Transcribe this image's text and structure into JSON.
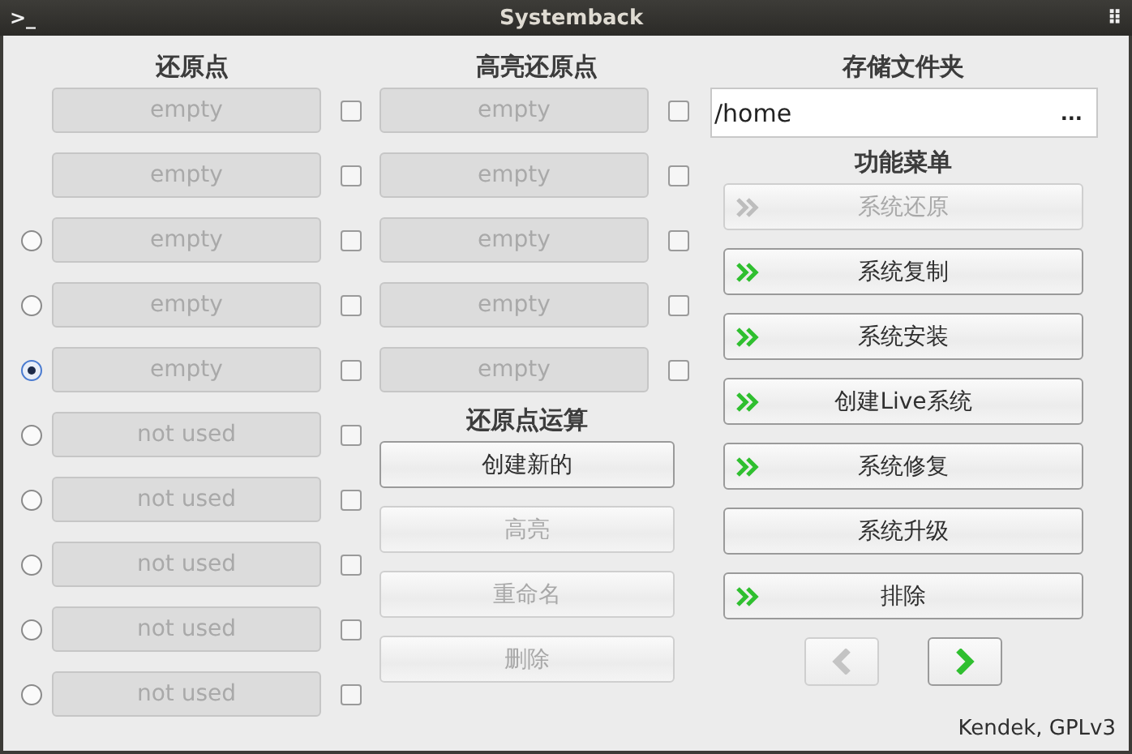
{
  "window": {
    "title": "Systemback",
    "terminal_glyph": ">_",
    "menu_glyph": "⠿"
  },
  "restore_points": {
    "title": "还原点",
    "items": [
      {
        "kind": "fixed",
        "text": "empty",
        "checked": false
      },
      {
        "kind": "fixed",
        "text": "empty",
        "checked": false
      },
      {
        "kind": "selectable",
        "text": "empty",
        "selected": false,
        "checked": false
      },
      {
        "kind": "selectable",
        "text": "empty",
        "selected": false,
        "checked": false
      },
      {
        "kind": "selectable",
        "text": "empty",
        "selected": true,
        "checked": false
      },
      {
        "kind": "selectable",
        "text": "not used",
        "selected": false,
        "checked": false
      },
      {
        "kind": "selectable",
        "text": "not used",
        "selected": false,
        "checked": false
      },
      {
        "kind": "selectable",
        "text": "not used",
        "selected": false,
        "checked": false
      },
      {
        "kind": "selectable",
        "text": "not used",
        "selected": false,
        "checked": false
      },
      {
        "kind": "selectable",
        "text": "not used",
        "selected": false,
        "checked": false
      }
    ]
  },
  "highlighted_points": {
    "title": "高亮还原点",
    "items": [
      {
        "text": "empty",
        "checked": false
      },
      {
        "text": "empty",
        "checked": false
      },
      {
        "text": "empty",
        "checked": false
      },
      {
        "text": "empty",
        "checked": false
      },
      {
        "text": "empty",
        "checked": false
      }
    ]
  },
  "operations": {
    "title": "还原点运算",
    "buttons": [
      {
        "label": "创建新的",
        "disabled": false
      },
      {
        "label": "高亮",
        "disabled": true
      },
      {
        "label": "重命名",
        "disabled": true
      },
      {
        "label": "删除",
        "disabled": true
      }
    ]
  },
  "storage": {
    "title": "存储文件夹",
    "path": "/home",
    "browse": "..."
  },
  "function_menu": {
    "title": "功能菜单",
    "buttons": [
      {
        "label": "系统还原",
        "disabled": true,
        "arrow": true
      },
      {
        "label": "系统复制",
        "disabled": false,
        "arrow": true
      },
      {
        "label": "系统安装",
        "disabled": false,
        "arrow": true
      },
      {
        "label": "创建Live系统",
        "disabled": false,
        "arrow": true
      },
      {
        "label": "系统修复",
        "disabled": false,
        "arrow": true
      },
      {
        "label": "系统升级",
        "disabled": false,
        "arrow": false
      },
      {
        "label": "排除",
        "disabled": false,
        "arrow": true
      }
    ]
  },
  "navigation": {
    "back_disabled": true,
    "forward_disabled": false
  },
  "footer": "Kendek, GPLv3"
}
